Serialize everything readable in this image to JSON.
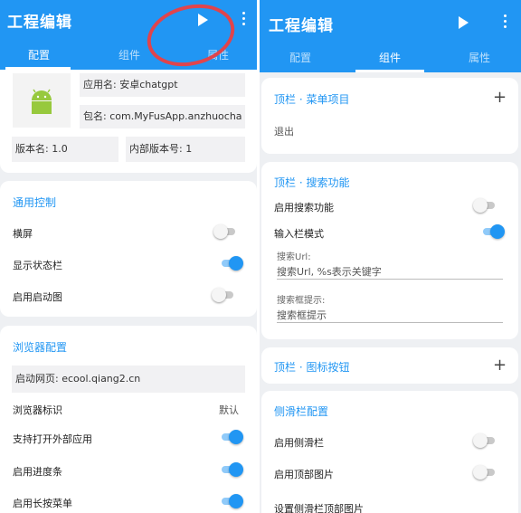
{
  "left": {
    "app_title": "工程编辑",
    "tabs": [
      {
        "label": "配置",
        "active": true
      },
      {
        "label": "组件",
        "active": false
      },
      {
        "label": "属性",
        "active": false
      }
    ],
    "app_info": {
      "app_name": "应用名: 安卓chatgpt",
      "package_name": "包名: com.MyFusApp.anzhuocha",
      "version_name": "版本名: 1.0",
      "version_code": "内部版本号: 1"
    },
    "general": {
      "title": "通用控制",
      "rows": [
        {
          "label": "横屏",
          "on": false
        },
        {
          "label": "显示状态栏",
          "on": true
        },
        {
          "label": "启用启动图",
          "on": false
        }
      ]
    },
    "browser": {
      "title": "浏览器配置",
      "start_page": "启动网页: ecool.qiang2.cn",
      "ua_label": "浏览器标识",
      "ua_value": "默认",
      "rows": [
        {
          "label": "支持打开外部应用",
          "on": true
        },
        {
          "label": "启用进度条",
          "on": true
        },
        {
          "label": "启用长按菜单",
          "on": true
        }
      ]
    }
  },
  "right": {
    "app_title": "工程编辑",
    "tabs": [
      {
        "label": "配置",
        "active": false
      },
      {
        "label": "组件",
        "active": true
      },
      {
        "label": "属性",
        "active": false
      }
    ],
    "menu": {
      "title": "顶栏 · 菜单项目",
      "item": "退出"
    },
    "search": {
      "title": "顶栏 · 搜索功能",
      "rows": [
        {
          "label": "启用搜索功能",
          "on": false
        },
        {
          "label": "输入栏模式",
          "on": true
        }
      ],
      "url_hint": "搜索Url:",
      "url_value": "搜索Url, %s表示关键字",
      "box_hint": "搜索框提示:",
      "box_value": "搜索框提示"
    },
    "icon_buttons": {
      "title": "顶栏 · 图标按钮"
    },
    "drawer": {
      "title": "侧滑栏配置",
      "rows": [
        {
          "label": "启用侧滑栏",
          "on": false
        },
        {
          "label": "启用顶部图片",
          "on": false
        }
      ],
      "set_image": "设置侧滑栏顶部图片"
    }
  },
  "colors": {
    "primary": "#2196f3",
    "annotation": "#e0444c",
    "background": "#eef0f3",
    "android": "#97c93d"
  }
}
